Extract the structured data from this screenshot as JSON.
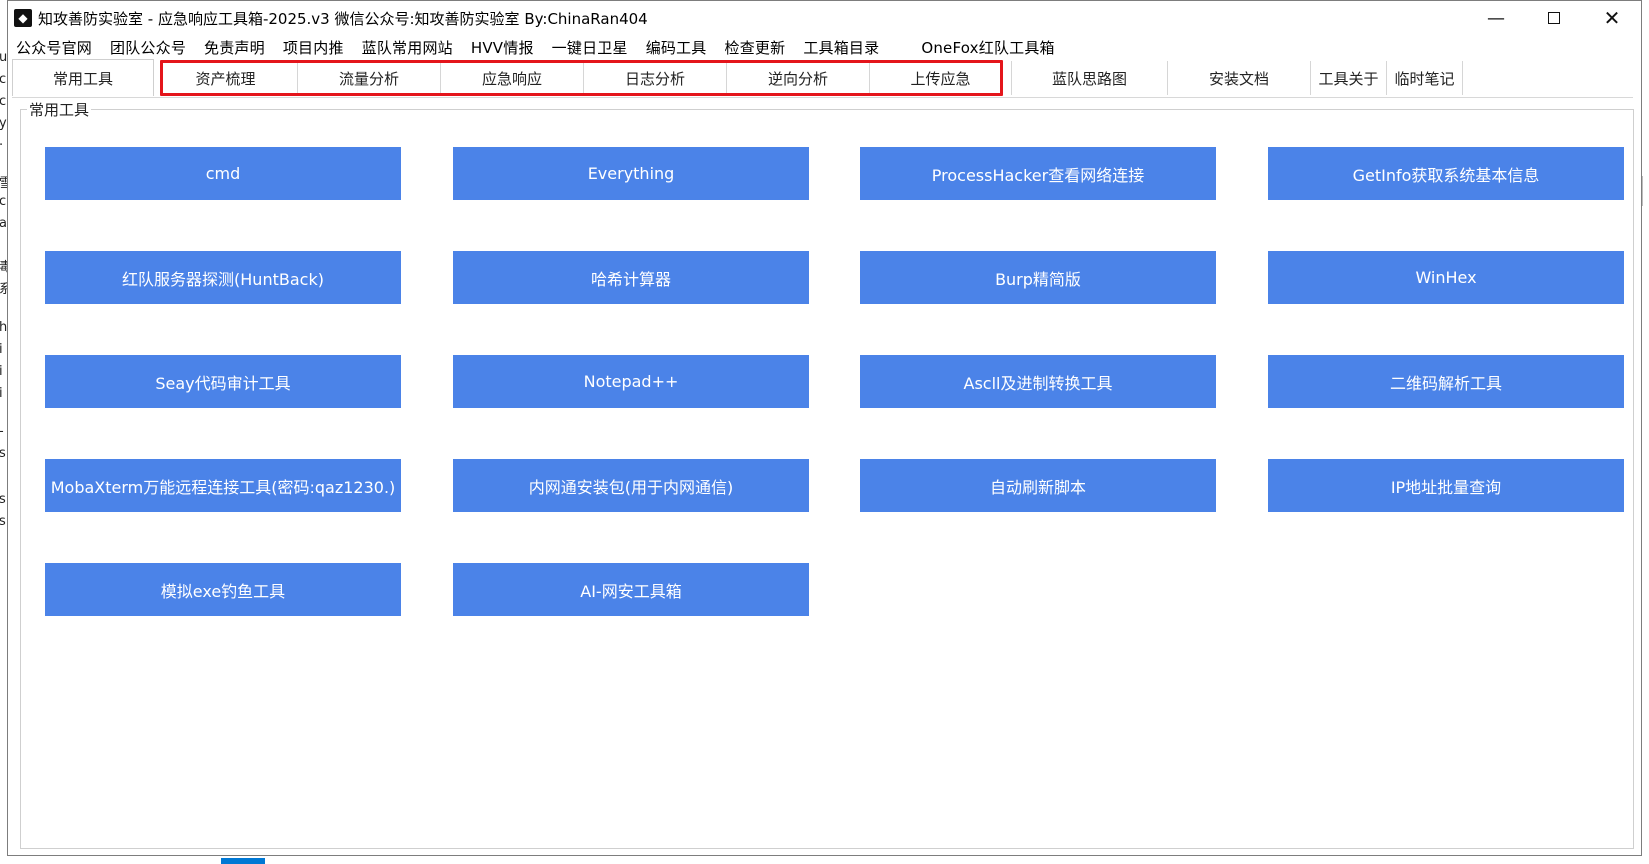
{
  "window": {
    "title": "知攻善防实验室 - 应急响应工具箱-2025.v3    微信公众号:知攻善防实验室    By:ChinaRan404",
    "controls": {
      "minimize": "—",
      "maximize": "□",
      "close": "✕"
    }
  },
  "menu": [
    "公众号官网",
    "团队公众号",
    "免责声明",
    "项目内推",
    "蓝队常用网站",
    "HVV情报",
    "一键日卫星",
    "编码工具",
    "检查更新",
    "工具箱目录",
    "OneFox红队工具箱"
  ],
  "tabs": [
    "常用工具",
    "资产梳理",
    "流量分析",
    "应急响应",
    "日志分析",
    "逆向分析",
    "上传应急",
    "蓝队思路图",
    "安装文档",
    "工具关于",
    "临时笔记"
  ],
  "section": {
    "label": "常用工具"
  },
  "tools": [
    "cmd",
    "Everything",
    "ProcessHacker查看网络连接",
    "GetInfo获取系统基本信息",
    "红队服务器探测(HuntBack)",
    "哈希计算器",
    "Burp精简版",
    "WinHex",
    "Seay代码审计工具",
    "Notepad++",
    "Ascll及进制转换工具",
    "二维码解析工具",
    "MobaXterm万能远程连接工具(密码:qaz1230.)",
    "内网通安装包(用于内网通信)",
    "自动刷新脚本",
    "IP地址批量查询",
    "模拟exe钓鱼工具",
    "AI-网安工具箱"
  ],
  "colors": {
    "button_blue": "#4b83e8",
    "highlight_red": "#e4151b"
  },
  "background_left_text": [
    "u",
    "c",
    "c",
    "y",
    "·",
    "雪",
    "c",
    "a",
    "毒",
    "系",
    "h",
    "i",
    "i",
    "i",
    "-",
    "s",
    "s",
    "s"
  ]
}
